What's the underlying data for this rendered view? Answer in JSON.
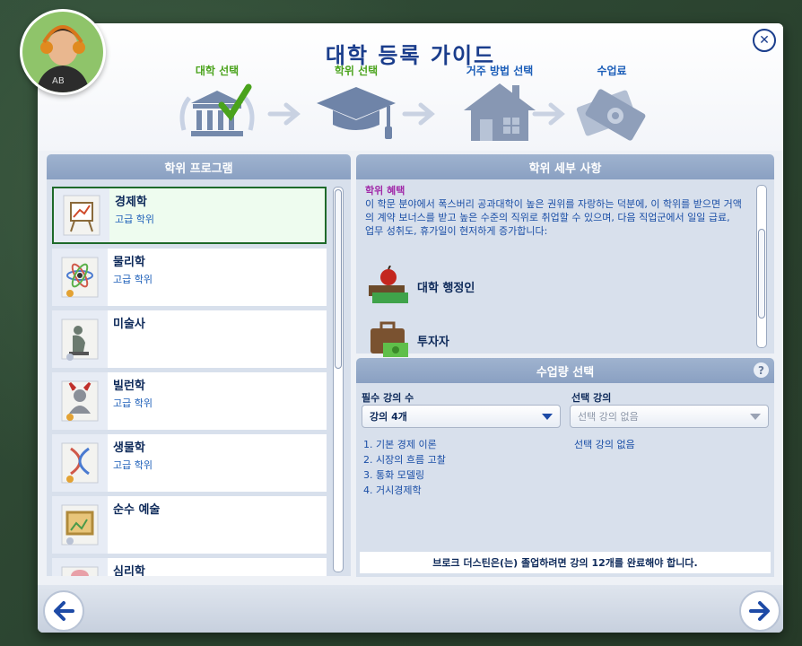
{
  "dialog": {
    "title": "대학 등록 가이드",
    "close_symbol": "✕"
  },
  "steps": [
    {
      "label": "대학 선택",
      "state": "done"
    },
    {
      "label": "학위 선택",
      "state": "done"
    },
    {
      "label": "거주 방법 선택",
      "state": "todo"
    },
    {
      "label": "수업료",
      "state": "todo"
    }
  ],
  "left_panel": {
    "title": "학위 프로그램",
    "degrees": [
      {
        "name": "경제학",
        "level": "고급 학위",
        "icon": "easel-chart-icon",
        "selected": true
      },
      {
        "name": "물리학",
        "level": "고급 학위",
        "icon": "atom-icon",
        "selected": false
      },
      {
        "name": "미술사",
        "level": "",
        "icon": "thinker-statue-icon",
        "selected": false
      },
      {
        "name": "빌런학",
        "level": "고급 학위",
        "icon": "villain-bust-icon",
        "selected": false
      },
      {
        "name": "생물학",
        "level": "고급 학위",
        "icon": "dna-icon",
        "selected": false
      },
      {
        "name": "순수 예술",
        "level": "",
        "icon": "painting-frame-icon",
        "selected": false
      },
      {
        "name": "심리학",
        "level": "",
        "icon": "brain-icon",
        "selected": false
      }
    ]
  },
  "details_panel": {
    "title": "학위 세부 사항",
    "benefit_label": "학위 혜택",
    "description": "이 학문 분야에서 폭스버리 공과대학이 높은 권위를 자랑하는 덕분에, 이 학위를 받으면 거액의 계약 보너스를 받고 높은 수준의 직위로 취업할 수 있으며, 다음 직업군에서 일일 급료, 업무 성취도, 휴가일이 현저하게 증가합니다:",
    "careers": [
      {
        "name": "대학 행정인",
        "icon": "books-apple-icon"
      },
      {
        "name": "투자자",
        "icon": "briefcase-money-icon"
      }
    ]
  },
  "course_panel": {
    "title": "수업량 선택",
    "help_symbol": "?",
    "required_label": "필수 강의 수",
    "required_value": "강의 4개",
    "elective_label": "선택 강의",
    "elective_value": "선택 강의 없음",
    "required_courses": [
      "1. 기본 경제 이론",
      "2. 시장의 흐름 고찰",
      "3. 통화 모델링",
      "4. 거시경제학"
    ],
    "elective_courses_text": "선택 강의 없음",
    "footer_note": "브로크 더스틴은(는) 졸업하려면 강의 12개를 완료해야 합니다."
  },
  "colors": {
    "accent": "#1a3d8c",
    "done": "#4aa31c",
    "panel_head": "#8aa0c2"
  }
}
